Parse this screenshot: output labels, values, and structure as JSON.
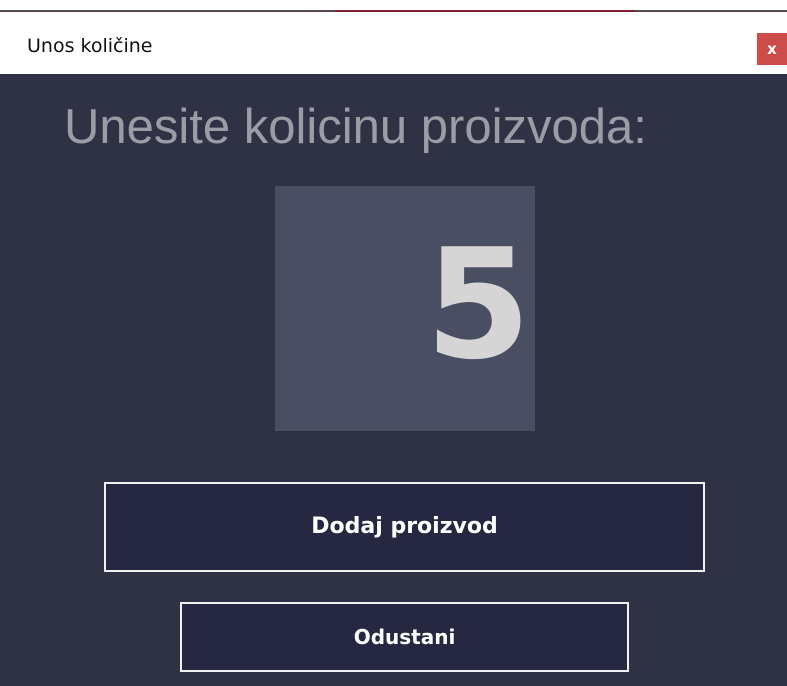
{
  "window": {
    "title": "Unos količine",
    "close_label": "x"
  },
  "prompt": {
    "text": "Unesite kolicinu proizvoda:"
  },
  "quantity": {
    "value": "5"
  },
  "actions": {
    "add_label": "Dodaj proizvod",
    "cancel_label": "Odustani"
  },
  "colors": {
    "background": "#2f3245",
    "quantity_box": "#4a4e63",
    "button_bg": "#262841",
    "button_border": "#f2f2f2",
    "close_button": "#cc4b4b",
    "prompt_text": "#9b9da6",
    "quantity_text": "#d5d5d5"
  }
}
